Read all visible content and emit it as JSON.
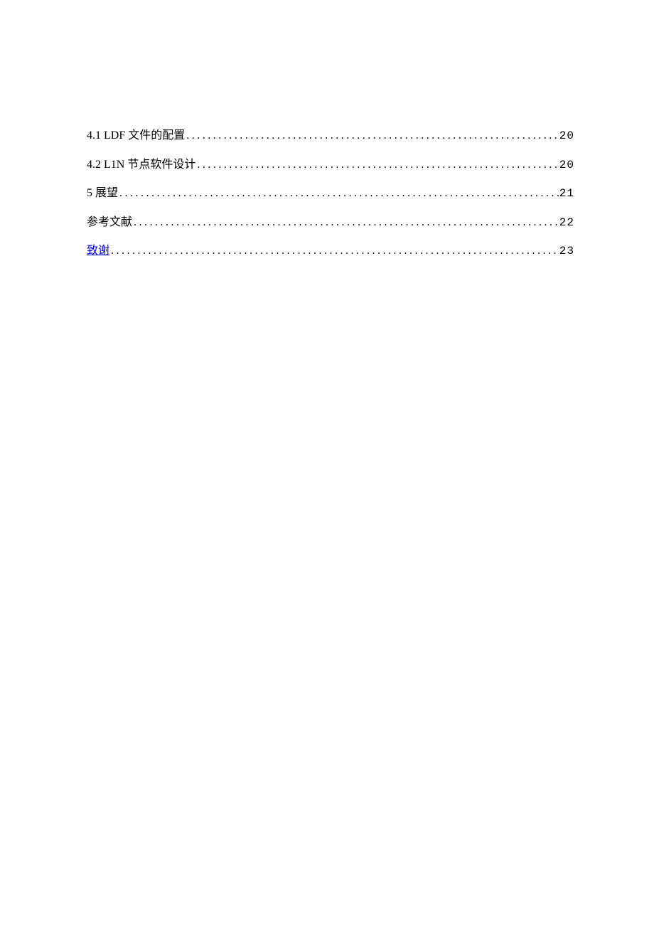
{
  "toc": [
    {
      "label": "4.1  LDF 文件的配置",
      "page": "20",
      "isLink": false
    },
    {
      "label": "4.2  L1N 节点软件设计",
      "page": "20",
      "isLink": false
    },
    {
      "label": "5 展望",
      "page": "21",
      "isLink": false
    },
    {
      "label": "参考文献",
      "page": "22",
      "isLink": false
    },
    {
      "label": "致谢",
      "page": "23",
      "isLink": true
    }
  ]
}
